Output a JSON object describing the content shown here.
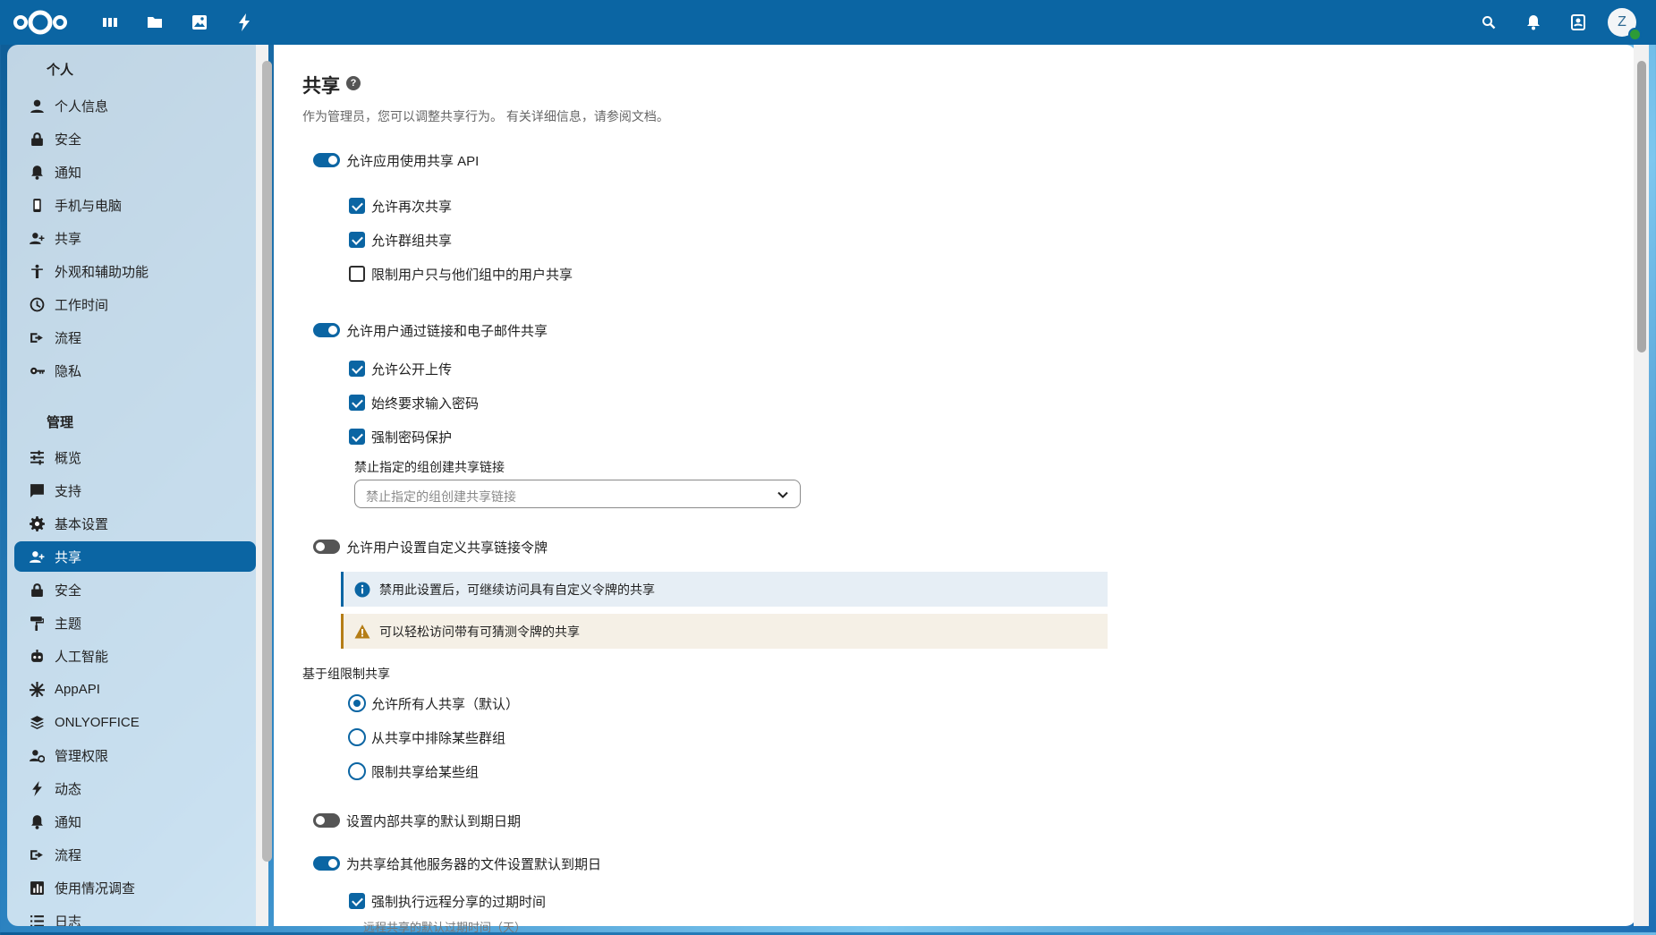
{
  "topbar": {
    "apps": [
      "dashboard-icon",
      "files-icon",
      "photos-icon",
      "activity-icon"
    ],
    "right_icons": [
      "search-icon",
      "bell-icon",
      "contacts-icon"
    ],
    "avatar_letter": "Z"
  },
  "sidebar": {
    "personal_title": "个人",
    "personal_items": [
      {
        "label": "个人信息",
        "icon": "person-icon"
      },
      {
        "label": "安全",
        "icon": "lock-icon"
      },
      {
        "label": "通知",
        "icon": "bell-icon"
      },
      {
        "label": "手机与电脑",
        "icon": "phone-icon"
      },
      {
        "label": "共享",
        "icon": "share-icon"
      },
      {
        "label": "外观和辅助功能",
        "icon": "accessibility-icon"
      },
      {
        "label": "工作时间",
        "icon": "clock-icon"
      },
      {
        "label": "流程",
        "icon": "flow-icon"
      },
      {
        "label": "隐私",
        "icon": "key-icon"
      }
    ],
    "admin_title": "管理",
    "admin_items": [
      {
        "label": "概览",
        "icon": "tune-icon"
      },
      {
        "label": "支持",
        "icon": "chat-icon"
      },
      {
        "label": "基本设置",
        "icon": "gear-icon"
      },
      {
        "label": "共享",
        "icon": "share-icon",
        "active": true
      },
      {
        "label": "安全",
        "icon": "lock-icon"
      },
      {
        "label": "主题",
        "icon": "paint-icon"
      },
      {
        "label": "人工智能",
        "icon": "robot-icon"
      },
      {
        "label": "AppAPI",
        "icon": "appapi-icon"
      },
      {
        "label": "ONLYOFFICE",
        "icon": "layers-icon"
      },
      {
        "label": "管理权限",
        "icon": "admin-icon"
      },
      {
        "label": "动态",
        "icon": "bolt-icon"
      },
      {
        "label": "通知",
        "icon": "bell-icon"
      },
      {
        "label": "流程",
        "icon": "flow-icon"
      },
      {
        "label": "使用情况调查",
        "icon": "chart-icon"
      },
      {
        "label": "日志",
        "icon": "list-icon"
      }
    ]
  },
  "main": {
    "title": "共享",
    "description": "作为管理员，您可以调整共享行为。 有关详细信息，请参阅文档。",
    "toggles": {
      "api": {
        "label": "允许应用使用共享 API",
        "on": true
      },
      "links": {
        "label": "允许用户通过链接和电子邮件共享",
        "on": true
      },
      "custom_token": {
        "label": "允许用户设置自定义共享链接令牌",
        "on": false
      },
      "internal_expiry": {
        "label": "设置内部共享的默认到期日期",
        "on": false
      },
      "remote_expiry": {
        "label": "为共享给其他服务器的文件设置默认到期日",
        "on": true
      }
    },
    "checkboxes": {
      "reshare": {
        "label": "允许再次共享",
        "checked": true
      },
      "group_share": {
        "label": "允许群组共享",
        "checked": true
      },
      "restrict_groups": {
        "label": "限制用户只与他们组中的用户共享",
        "checked": false
      },
      "public_upload": {
        "label": "允许公开上传",
        "checked": true
      },
      "require_password": {
        "label": "始终要求输入密码",
        "checked": true
      },
      "enforce_password": {
        "label": "强制密码保护",
        "checked": true
      },
      "enforce_remote_expiry": {
        "label": "强制执行远程分享的过期时间",
        "checked": true
      }
    },
    "exclude_groups": {
      "label": "禁止指定的组创建共享链接",
      "placeholder": "禁止指定的组创建共享链接"
    },
    "info_note": "禁用此设置后，可继续访问具有自定义令牌的共享",
    "warn_note": "可以轻松访问带有可猜测令牌的共享",
    "group_restriction": {
      "title": "基于组限制共享",
      "options": [
        {
          "label": "允许所有人共享（默认）",
          "selected": true
        },
        {
          "label": "从共享中排除某些群组",
          "selected": false
        },
        {
          "label": "限制共享给某些组",
          "selected": false
        }
      ]
    },
    "remote_default_days_label": "远程共享的默认过期时间（天）"
  }
}
